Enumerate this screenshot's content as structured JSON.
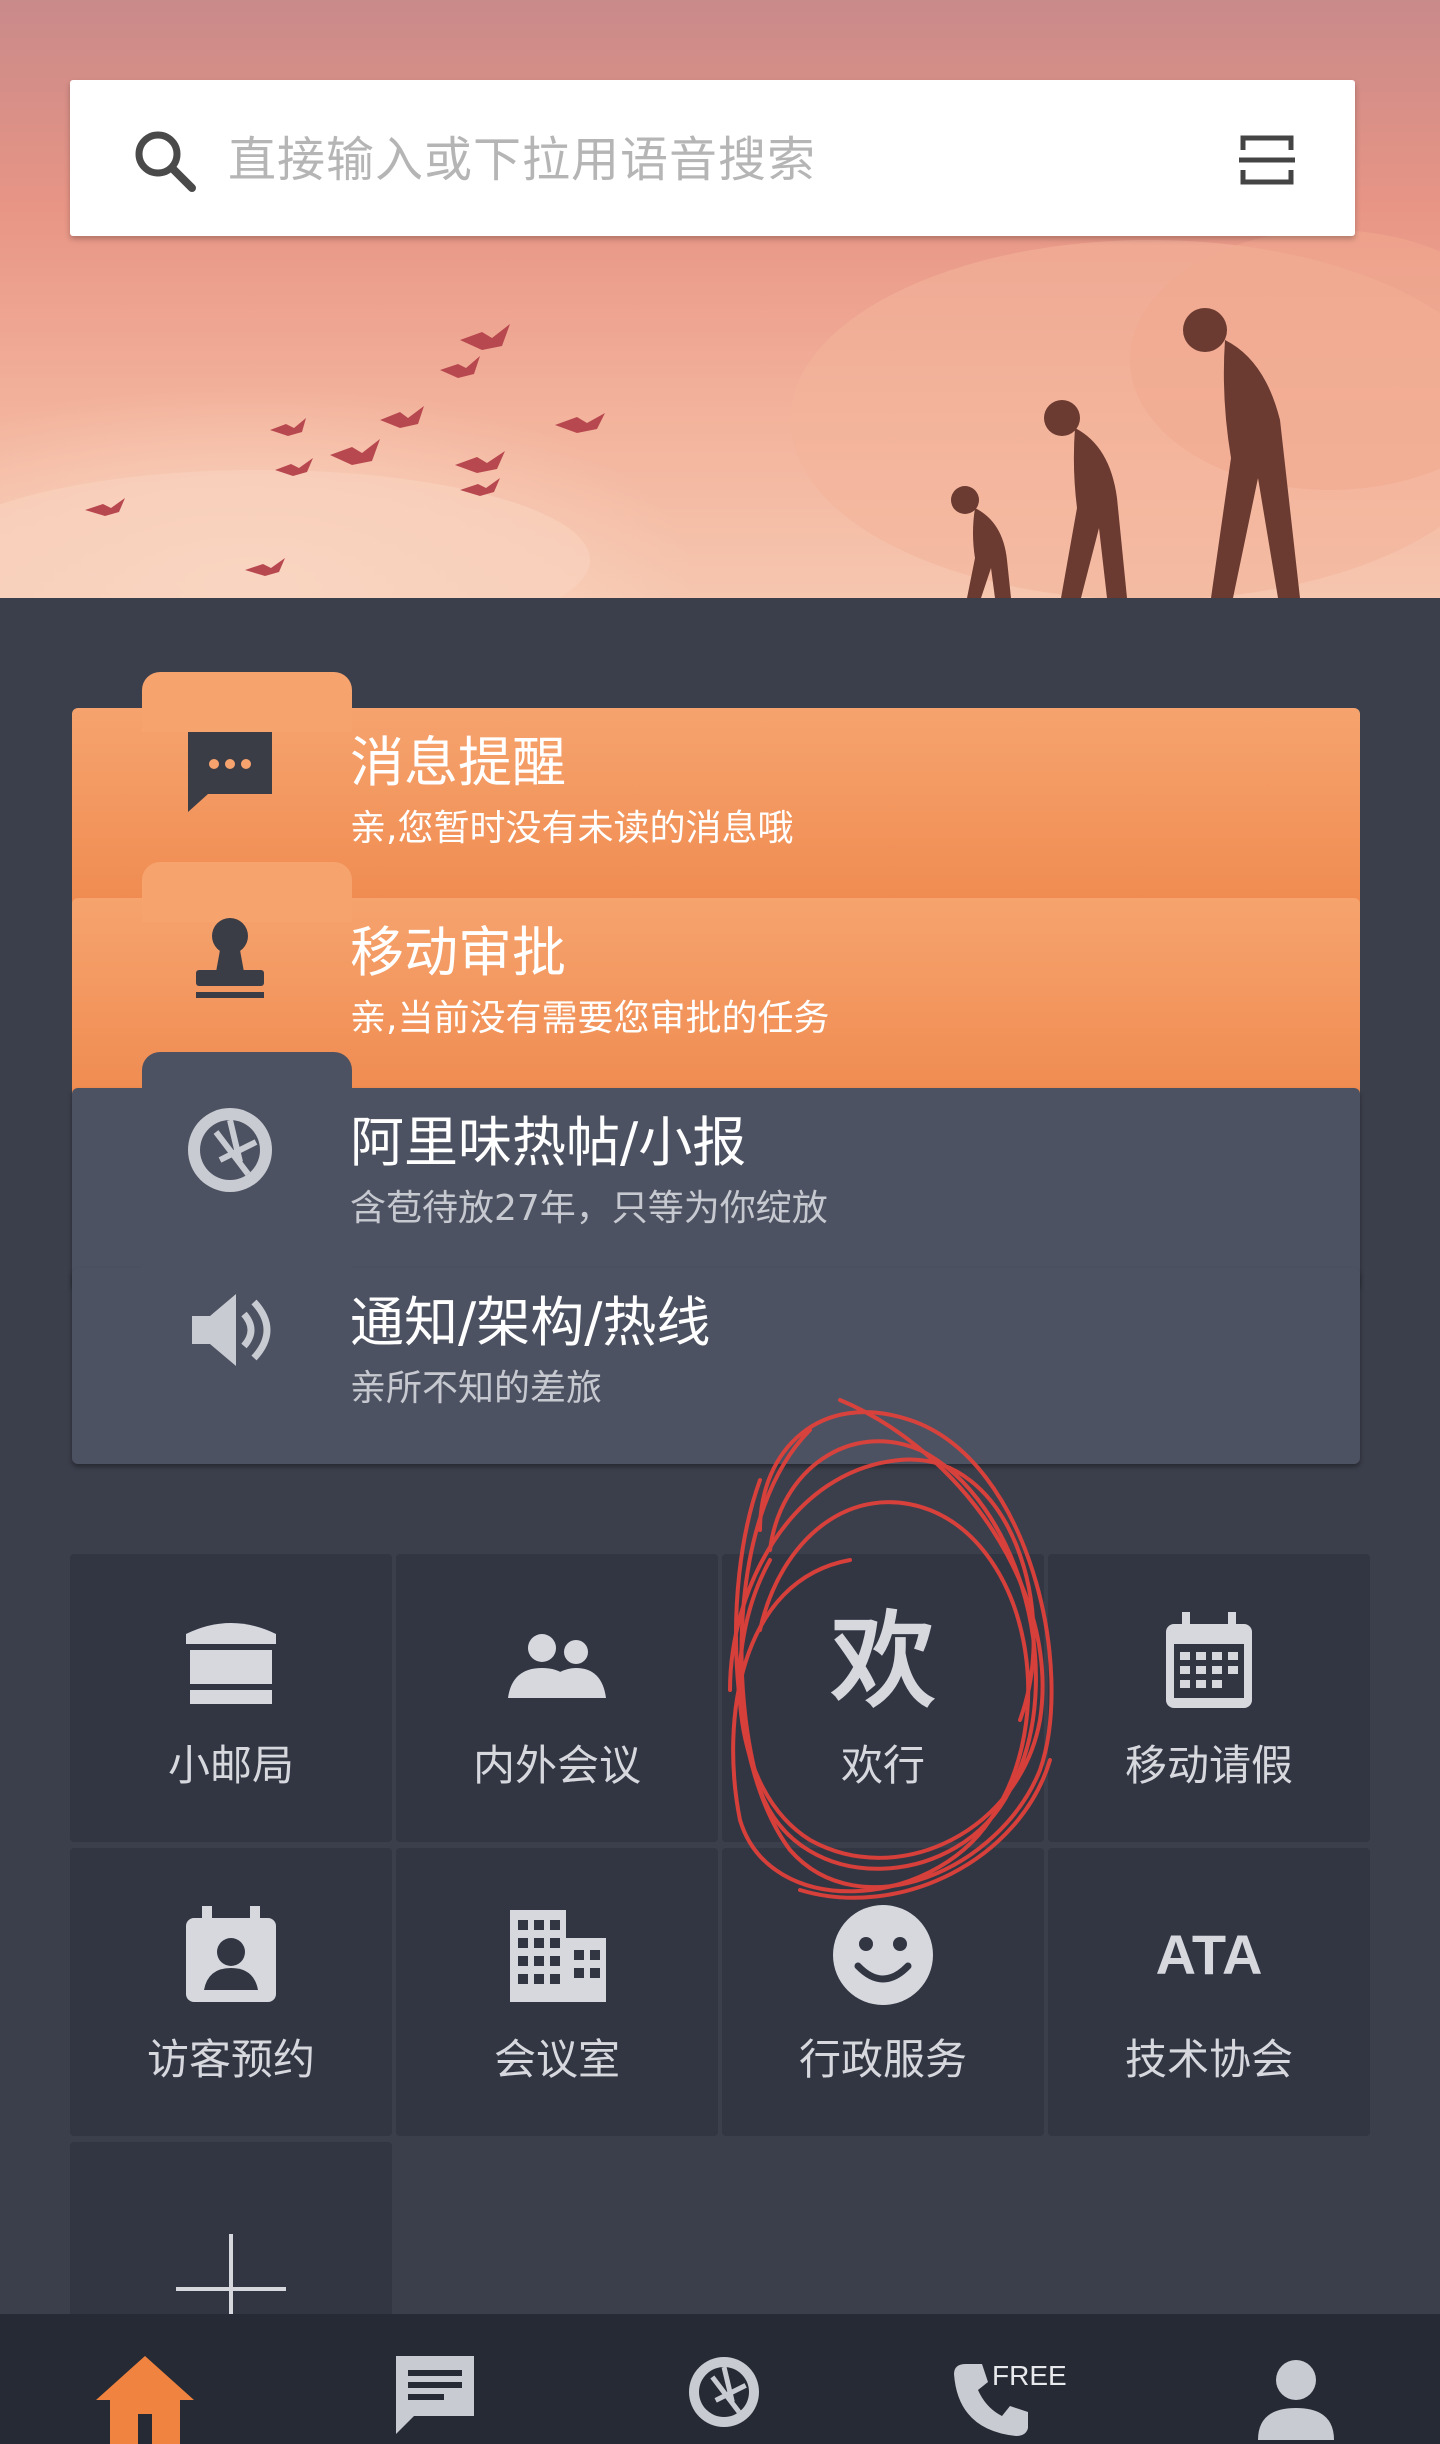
{
  "search": {
    "placeholder": "直接输入或下拉用语音搜索",
    "scan_icon": "scan-icon"
  },
  "cards": [
    {
      "icon": "chat-icon",
      "title": "消息提醒",
      "subtitle": "亲,您暂时没有未读的消息哦",
      "style": "orange"
    },
    {
      "icon": "stamp-icon",
      "title": "移动审批",
      "subtitle": "亲,当前没有需要您审批的任务",
      "style": "orange"
    },
    {
      "icon": "aperture-icon",
      "title": "阿里味热帖/小报",
      "subtitle": "含苞待放27年，只等为你绽放",
      "style": "gray"
    },
    {
      "icon": "speaker-icon",
      "title": "通知/架构/热线",
      "subtitle": "亲所不知的差旅",
      "style": "gray"
    }
  ],
  "tiles": [
    {
      "icon": "mailbox-icon",
      "label": "小邮局"
    },
    {
      "icon": "people-icon",
      "label": "内外会议"
    },
    {
      "icon": "huan-char-icon",
      "icon_text": "欢",
      "label": "欢行"
    },
    {
      "icon": "calendar-icon",
      "label": "移动请假"
    },
    {
      "icon": "visitor-badge-icon",
      "label": "访客预约"
    },
    {
      "icon": "building-icon",
      "label": "会议室"
    },
    {
      "icon": "smiley-icon",
      "label": "行政服务"
    },
    {
      "icon": "ata-text-icon",
      "icon_text": "ATA",
      "label": "技术协会"
    },
    {
      "icon": "plus-icon",
      "label": ""
    }
  ],
  "bottom_nav": [
    {
      "icon": "home-icon",
      "active": true
    },
    {
      "icon": "message-icon",
      "active": false
    },
    {
      "icon": "aperture-icon",
      "active": false
    },
    {
      "icon": "phone-icon",
      "badge": "FREE",
      "active": false
    },
    {
      "icon": "profile-icon",
      "active": false
    }
  ],
  "colors": {
    "accent_orange": "#ef8a4f",
    "background": "#3b3f4b",
    "tile_bg": "#323643",
    "annotation_red": "#e8413a"
  }
}
